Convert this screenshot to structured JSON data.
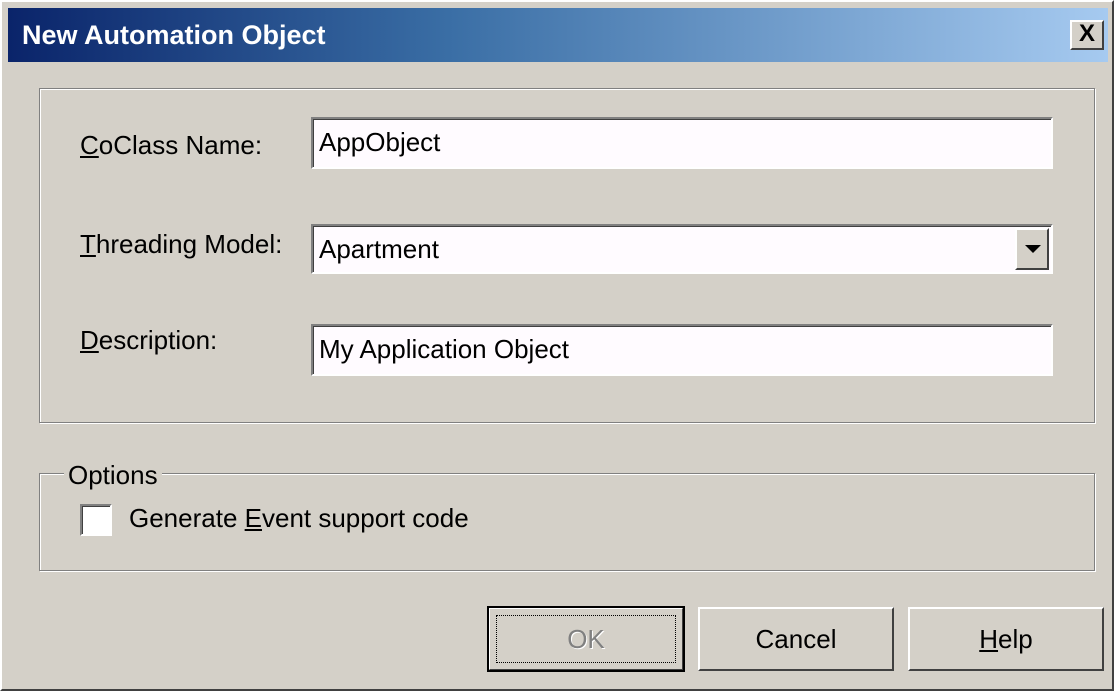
{
  "dialog": {
    "title": "New Automation Object",
    "close_label": "X"
  },
  "fields": {
    "coclass": {
      "label_prefix": "",
      "label_access": "C",
      "label_rest": "oClass Name:",
      "value": "AppObject"
    },
    "threading": {
      "label_prefix": "",
      "label_access": "T",
      "label_rest": "hreading Model:",
      "value": "Apartment"
    },
    "description": {
      "label_prefix": "",
      "label_access": "D",
      "label_rest": "escription:",
      "value": "My Application Object"
    }
  },
  "options": {
    "legend": "Options",
    "generate_event": {
      "label_prefix": "Generate ",
      "label_access": "E",
      "label_rest": "vent support code",
      "checked": false
    }
  },
  "buttons": {
    "ok": "OK",
    "cancel": "Cancel",
    "help_access": "H",
    "help_rest": "elp"
  }
}
